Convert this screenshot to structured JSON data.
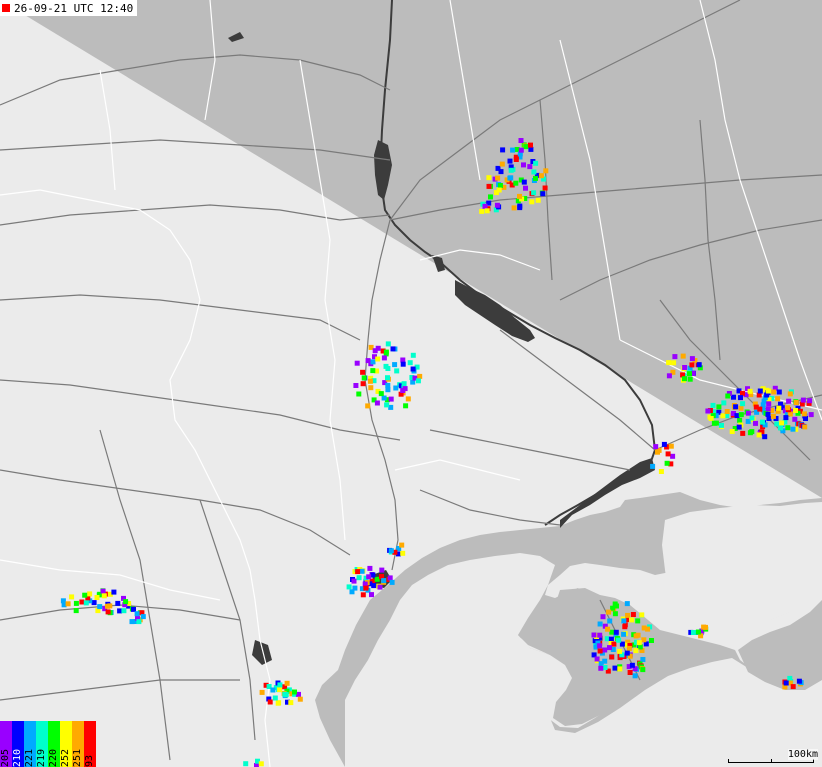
{
  "timestamp": "26-09-21 UTC 12:40",
  "legend": {
    "labels": [
      "205",
      "210",
      "221",
      "219",
      "220",
      "252",
      "251",
      "93"
    ],
    "colors": [
      "#9900ff",
      "#0000ff",
      "#00aaff",
      "#00ffcc",
      "#00ff00",
      "#ffff00",
      "#ffaa00",
      "#ff0000"
    ]
  },
  "scale": {
    "label": "100km"
  },
  "colors": {
    "land": "#bcbcbc",
    "sea": "#ebebeb",
    "water": "#3c3c3c",
    "roads": "#7a7a7a",
    "borders": "#ffffff"
  }
}
